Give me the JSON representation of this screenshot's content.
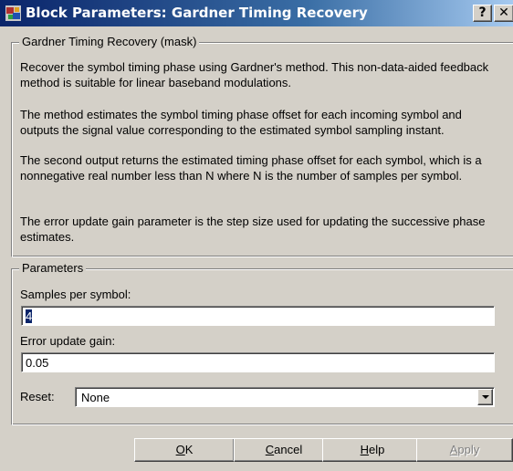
{
  "window": {
    "title": "Block Parameters: Gardner Timing Recovery",
    "help_label": "?",
    "close_label": "✕",
    "icon": "simulink-block-icon"
  },
  "mask": {
    "group_title": "Gardner Timing Recovery (mask)",
    "paragraphs": [
      "Recover the symbol timing phase using Gardner's method. This non-data-aided feedback method is suitable for linear baseband modulations.",
      "The method estimates the symbol timing phase offset for each incoming symbol and outputs the signal value corresponding to the estimated symbol sampling instant.",
      "The second output returns the estimated timing phase offset for each symbol, which is a nonnegative real number less than N where N is the number of samples per symbol.",
      "The error update gain parameter is the step size used for updating the successive phase estimates."
    ]
  },
  "params": {
    "group_title": "Parameters",
    "samples_label": "Samples per symbol:",
    "samples_value": "4",
    "gain_label": "Error update gain:",
    "gain_value": "0.05",
    "reset_label": "Reset:",
    "reset_value": "None"
  },
  "buttons": {
    "ok": {
      "mnemonic": "O",
      "rest": "K"
    },
    "cancel": {
      "mnemonic": "C",
      "rest": "ancel"
    },
    "help": {
      "mnemonic": "H",
      "rest": "elp"
    },
    "apply": {
      "mnemonic": "A",
      "rest": "pply"
    }
  }
}
